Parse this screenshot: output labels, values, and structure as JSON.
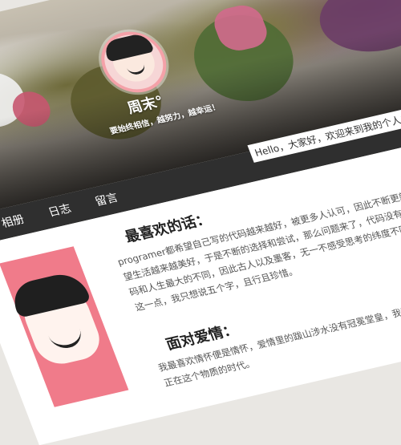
{
  "header": {
    "site_name": "周末°",
    "slogan": "要始终相信，越努力，越幸运！"
  },
  "nav": {
    "items": [
      "相册",
      "日志",
      "留言"
    ],
    "welcome": "Hello，大家好，欢迎来到我的个人主页！"
  },
  "main": {
    "favorite_title": "最喜欢的话：",
    "favorite_text": "programer都希望自己写的代码越来越好，被更多人认可，因此不断更新；样，希望生活越来越美好，于是不断的选择和尝试，那么问题来了，代码没有，这也是代码和人生最大的不同，因此古人以及墨客，无一不感受思考的纬度不同而已，对于这一点，我只想说五个字，且行且珍惜。",
    "love_title": "面对爱情：",
    "love_text": "我最喜欢情怀便是情怀，爱情里的跋山涉水没有冠冕堂皇，我不可否认纯纯的爱情正在这个物质的时代。"
  }
}
